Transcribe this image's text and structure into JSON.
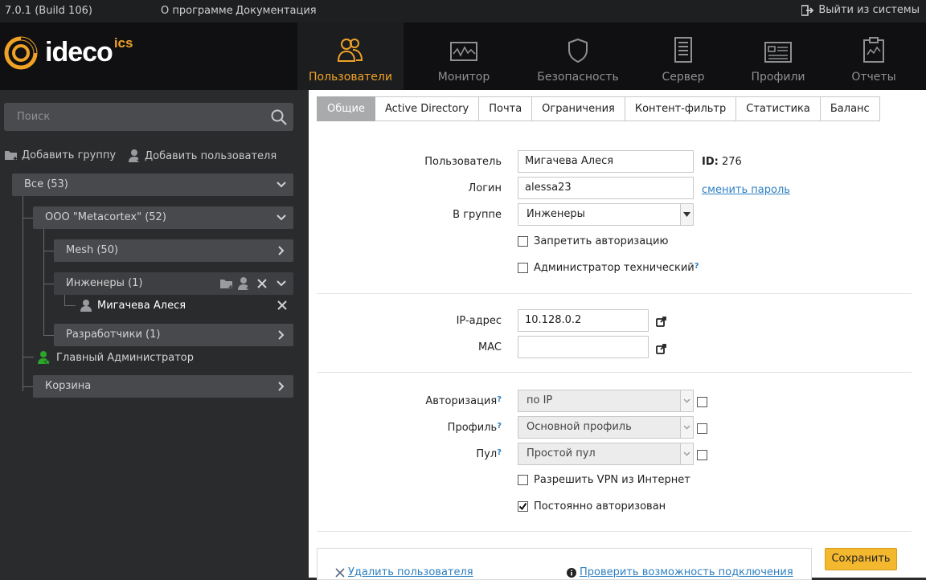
{
  "topbar": {
    "version": "7.0.1 (Build 106)",
    "about": "О программе",
    "docs": "Документация",
    "logout": "Выйти из системы"
  },
  "logo": {
    "text": "ideco",
    "suffix": "ics"
  },
  "nav": [
    {
      "label": "Пользователи",
      "icon": "users-icon",
      "active": true
    },
    {
      "label": "Монитор",
      "icon": "monitor-icon"
    },
    {
      "label": "Безопасность",
      "icon": "shield-icon"
    },
    {
      "label": "Сервер",
      "icon": "server-icon"
    },
    {
      "label": "Профили",
      "icon": "profile-card-icon"
    },
    {
      "label": "Отчеты",
      "icon": "clipboard-report-icon"
    }
  ],
  "sidebar": {
    "search_placeholder": "Поиск",
    "add_group": "Добавить группу",
    "add_user": "Добавить пользователя",
    "tree": {
      "all": "Все (53)",
      "org": "ООО \"Metacortex\" (52)",
      "mesh": "Mesh (50)",
      "engineers": "Инженеры (1)",
      "user": "Мигачева Алеся",
      "devs": "Разработчики (1)",
      "admin": "Главный Администратор",
      "trash": "Корзина"
    }
  },
  "tabs": [
    "Общие",
    "Active Directory",
    "Почта",
    "Ограничения",
    "Контент-фильтр",
    "Статистика",
    "Баланс"
  ],
  "form": {
    "user_label": "Пользователь",
    "user_value": "Мигачева Алеся",
    "id_label": "ID:",
    "id_value": "276",
    "login_label": "Логин",
    "login_value": "alessa23",
    "change_password": "сменить пароль",
    "group_label": "В группе",
    "group_value": "Инженеры",
    "deny_auth": "Запретить авторизацию",
    "tech_admin": "Администратор технический",
    "ip_label": "IP-адрес",
    "ip_value": "10.128.0.2",
    "mac_label": "MAC",
    "mac_value": "",
    "auth_label": "Авторизация",
    "auth_value": "по IP",
    "profile_label": "Профиль",
    "profile_value": "Основной профиль",
    "pool_label": "Пул",
    "pool_value": "Простой пул",
    "allow_vpn": "Разрешить VPN из Интернет",
    "always_auth": "Постоянно авторизован",
    "always_auth_checked": true,
    "q": "?"
  },
  "actions": {
    "delete_user": "Удалить пользователя",
    "check_conn": "Проверить возможность подключения",
    "save": "Сохранить"
  }
}
